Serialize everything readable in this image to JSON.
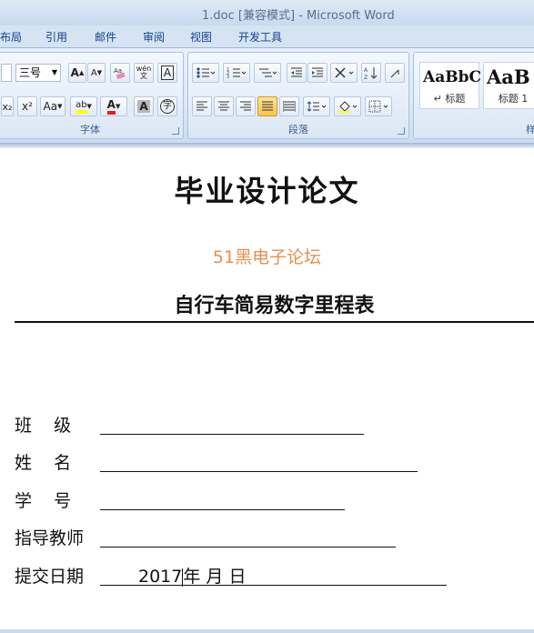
{
  "window": {
    "title": "1.doc [兼容模式] - Microsoft Word"
  },
  "tabs": [
    {
      "label": "布局"
    },
    {
      "label": "引用"
    },
    {
      "label": "邮件"
    },
    {
      "label": "审阅"
    },
    {
      "label": "视图"
    },
    {
      "label": "开发工具"
    }
  ],
  "ribbon": {
    "font_group": {
      "label": "字体",
      "font_size": "三号",
      "grow_label": "A",
      "shrink_label": "A",
      "phonetic_label": "wén",
      "char_border_label": "A",
      "subscript_label": "x₂",
      "superscript_label": "x²",
      "change_case_label": "Aa",
      "highlight_label": "ab",
      "font_color_label": "A",
      "char_shade_label": "A",
      "enclose_label": "字"
    },
    "paragraph_group": {
      "label": "段落"
    },
    "styles_group": {
      "label": "样",
      "styles": [
        {
          "sample": "AaBbC",
          "name": "标题"
        },
        {
          "sample": "AaB",
          "name": "标题 1"
        }
      ]
    }
  },
  "colors": {
    "watermark": "#e4904d",
    "highlight": "#ffff00",
    "font_color": "#e81c1c"
  },
  "document": {
    "title": "毕业设计论文",
    "watermark": "51黑电子论坛",
    "subject": "自行车简易数字里程表",
    "fields": [
      {
        "label": "班    级",
        "value": ""
      },
      {
        "label": "姓    名",
        "value": ""
      },
      {
        "label": "学    号",
        "value": ""
      },
      {
        "label": "指导教师",
        "value": ""
      },
      {
        "label": "提交日期",
        "value_year": "2017",
        "value_rest": "年   月   日"
      }
    ]
  }
}
